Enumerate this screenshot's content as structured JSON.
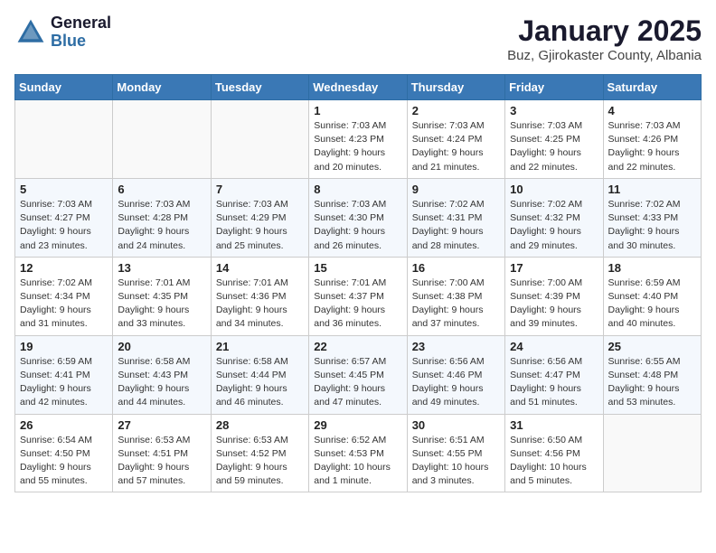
{
  "header": {
    "logo_general": "General",
    "logo_blue": "Blue",
    "month": "January 2025",
    "location": "Buz, Gjirokaster County, Albania"
  },
  "weekdays": [
    "Sunday",
    "Monday",
    "Tuesday",
    "Wednesday",
    "Thursday",
    "Friday",
    "Saturday"
  ],
  "weeks": [
    [
      {
        "day": "",
        "info": ""
      },
      {
        "day": "",
        "info": ""
      },
      {
        "day": "",
        "info": ""
      },
      {
        "day": "1",
        "info": "Sunrise: 7:03 AM\nSunset: 4:23 PM\nDaylight: 9 hours\nand 20 minutes."
      },
      {
        "day": "2",
        "info": "Sunrise: 7:03 AM\nSunset: 4:24 PM\nDaylight: 9 hours\nand 21 minutes."
      },
      {
        "day": "3",
        "info": "Sunrise: 7:03 AM\nSunset: 4:25 PM\nDaylight: 9 hours\nand 22 minutes."
      },
      {
        "day": "4",
        "info": "Sunrise: 7:03 AM\nSunset: 4:26 PM\nDaylight: 9 hours\nand 22 minutes."
      }
    ],
    [
      {
        "day": "5",
        "info": "Sunrise: 7:03 AM\nSunset: 4:27 PM\nDaylight: 9 hours\nand 23 minutes."
      },
      {
        "day": "6",
        "info": "Sunrise: 7:03 AM\nSunset: 4:28 PM\nDaylight: 9 hours\nand 24 minutes."
      },
      {
        "day": "7",
        "info": "Sunrise: 7:03 AM\nSunset: 4:29 PM\nDaylight: 9 hours\nand 25 minutes."
      },
      {
        "day": "8",
        "info": "Sunrise: 7:03 AM\nSunset: 4:30 PM\nDaylight: 9 hours\nand 26 minutes."
      },
      {
        "day": "9",
        "info": "Sunrise: 7:02 AM\nSunset: 4:31 PM\nDaylight: 9 hours\nand 28 minutes."
      },
      {
        "day": "10",
        "info": "Sunrise: 7:02 AM\nSunset: 4:32 PM\nDaylight: 9 hours\nand 29 minutes."
      },
      {
        "day": "11",
        "info": "Sunrise: 7:02 AM\nSunset: 4:33 PM\nDaylight: 9 hours\nand 30 minutes."
      }
    ],
    [
      {
        "day": "12",
        "info": "Sunrise: 7:02 AM\nSunset: 4:34 PM\nDaylight: 9 hours\nand 31 minutes."
      },
      {
        "day": "13",
        "info": "Sunrise: 7:01 AM\nSunset: 4:35 PM\nDaylight: 9 hours\nand 33 minutes."
      },
      {
        "day": "14",
        "info": "Sunrise: 7:01 AM\nSunset: 4:36 PM\nDaylight: 9 hours\nand 34 minutes."
      },
      {
        "day": "15",
        "info": "Sunrise: 7:01 AM\nSunset: 4:37 PM\nDaylight: 9 hours\nand 36 minutes."
      },
      {
        "day": "16",
        "info": "Sunrise: 7:00 AM\nSunset: 4:38 PM\nDaylight: 9 hours\nand 37 minutes."
      },
      {
        "day": "17",
        "info": "Sunrise: 7:00 AM\nSunset: 4:39 PM\nDaylight: 9 hours\nand 39 minutes."
      },
      {
        "day": "18",
        "info": "Sunrise: 6:59 AM\nSunset: 4:40 PM\nDaylight: 9 hours\nand 40 minutes."
      }
    ],
    [
      {
        "day": "19",
        "info": "Sunrise: 6:59 AM\nSunset: 4:41 PM\nDaylight: 9 hours\nand 42 minutes."
      },
      {
        "day": "20",
        "info": "Sunrise: 6:58 AM\nSunset: 4:43 PM\nDaylight: 9 hours\nand 44 minutes."
      },
      {
        "day": "21",
        "info": "Sunrise: 6:58 AM\nSunset: 4:44 PM\nDaylight: 9 hours\nand 46 minutes."
      },
      {
        "day": "22",
        "info": "Sunrise: 6:57 AM\nSunset: 4:45 PM\nDaylight: 9 hours\nand 47 minutes."
      },
      {
        "day": "23",
        "info": "Sunrise: 6:56 AM\nSunset: 4:46 PM\nDaylight: 9 hours\nand 49 minutes."
      },
      {
        "day": "24",
        "info": "Sunrise: 6:56 AM\nSunset: 4:47 PM\nDaylight: 9 hours\nand 51 minutes."
      },
      {
        "day": "25",
        "info": "Sunrise: 6:55 AM\nSunset: 4:48 PM\nDaylight: 9 hours\nand 53 minutes."
      }
    ],
    [
      {
        "day": "26",
        "info": "Sunrise: 6:54 AM\nSunset: 4:50 PM\nDaylight: 9 hours\nand 55 minutes."
      },
      {
        "day": "27",
        "info": "Sunrise: 6:53 AM\nSunset: 4:51 PM\nDaylight: 9 hours\nand 57 minutes."
      },
      {
        "day": "28",
        "info": "Sunrise: 6:53 AM\nSunset: 4:52 PM\nDaylight: 9 hours\nand 59 minutes."
      },
      {
        "day": "29",
        "info": "Sunrise: 6:52 AM\nSunset: 4:53 PM\nDaylight: 10 hours\nand 1 minute."
      },
      {
        "day": "30",
        "info": "Sunrise: 6:51 AM\nSunset: 4:55 PM\nDaylight: 10 hours\nand 3 minutes."
      },
      {
        "day": "31",
        "info": "Sunrise: 6:50 AM\nSunset: 4:56 PM\nDaylight: 10 hours\nand 5 minutes."
      },
      {
        "day": "",
        "info": ""
      }
    ]
  ]
}
